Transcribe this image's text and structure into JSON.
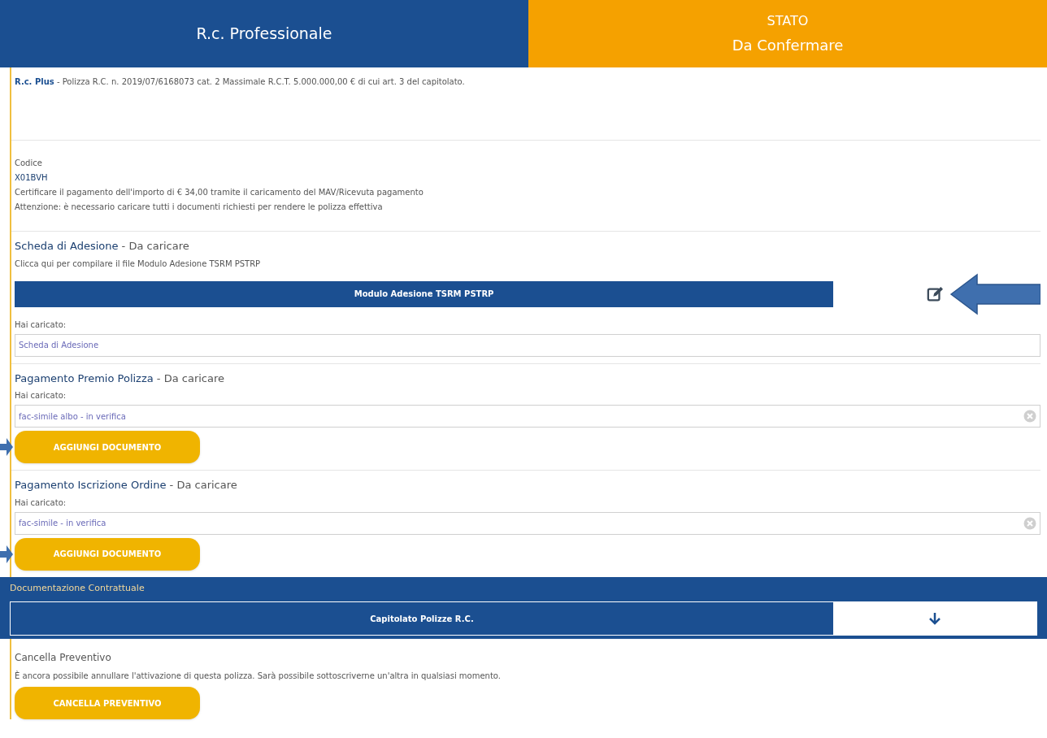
{
  "header": {
    "title": "R.c. Professionale",
    "status_label": "STATO",
    "status_value": "Da Confermare"
  },
  "policy": {
    "name": "R.c. Plus",
    "description": " - Polizza R.C. n. 2019/07/6168073 cat. 2 Massimale R.C.T. 5.000.000,00 € di cui art. 3 del capitolato."
  },
  "info": {
    "code_label": "Codice",
    "code": "X01BVH",
    "lines": [
      "Certificare il pagamento dell'importo di € 34,00 tramite il caricamento del MAV/Ricevuta pagamento",
      "Attenzione: è necessario caricare tutti i documenti richiesti per rendere le polizza effettiva"
    ]
  },
  "documents": [
    {
      "title": "Scheda di Adesione",
      "status": " - Da caricare",
      "hint": "Clicca qui per compilare il file Modulo Adesione TSRM PSTRP",
      "form_button": "Modulo Adesione TSRM PSTRP",
      "uploaded_label": "Hai caricato:",
      "uploaded_value": "Scheda di Adesione",
      "removable": false
    },
    {
      "title": "Pagamento Premio Polizza",
      "status": " - Da caricare",
      "uploaded_label": "Hai caricato:",
      "uploaded_value": "fac-simile albo - in verifica",
      "removable": true,
      "add_button": "AGGIUNGI DOCUMENTO"
    },
    {
      "title": "Pagamento Iscrizione Ordine",
      "status": " - Da caricare",
      "uploaded_label": "Hai caricato:",
      "uploaded_value": "fac-simile - in verifica",
      "removable": true,
      "add_button": "AGGIUNGI DOCUMENTO"
    }
  ],
  "contract": {
    "title": "Documentazione Contrattuale",
    "document": "Capitolato Polizze R.C."
  },
  "cancel": {
    "title": "Cancella Preventivo",
    "text": "È ancora possibile annullare l'attivazione di questa polizza. Sarà possibile sottoscriverne un'altra in qualsiasi momento.",
    "button": "CANCELLA PREVENTIVO"
  }
}
